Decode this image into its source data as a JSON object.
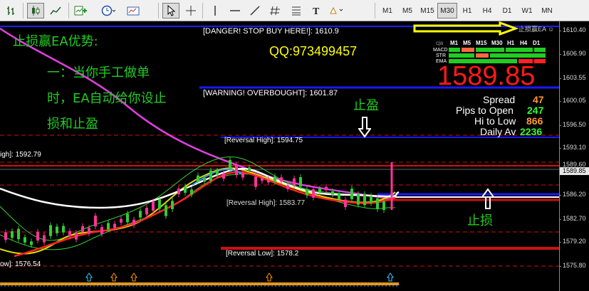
{
  "toolbar": {
    "icons": [
      "bar-chart-icon",
      "candlestick-icon",
      "line-chart-icon",
      "new-chart-icon",
      "clock-icon",
      "zoom-in-icon",
      "zoom-out-icon",
      "templates-icon",
      "cursor-icon",
      "crosshair-icon",
      "vertical-line-icon",
      "horizontal-line-icon",
      "trendline-icon",
      "hash-icon",
      "text-icon",
      "fibonacci-icon",
      "shapes-icon"
    ],
    "timeframes": [
      "M1",
      "M5",
      "M15",
      "M30",
      "H1",
      "H4",
      "D1",
      "W1",
      "MN"
    ],
    "selected_timeframe": "M30"
  },
  "overlay": {
    "heading": "止损赢EA优势:",
    "line1": "一：当你手工做单",
    "line2": "时，EA自动给你设止",
    "line3": "损和止盈",
    "qq": "QQ:973499457",
    "take_profit": "止盈",
    "stop_loss": "止损",
    "corner_label": "止损赢EA ☺",
    "danger": "[DANGER! STOP BUY HERE!]: 1610.9",
    "warning": "[WARNING! OVERBOUGHT]: 1601.87",
    "reversal_high": "[Reversal High]: 1594.75",
    "reversal_low": "[Reversal Low]: 1578.2",
    "left_high": "igh]: 1592.79",
    "left_low": "ow]: 1576.54",
    "overlap_text": "[Reversal High]: 1583.77"
  },
  "panel": {
    "header": [
      "cja",
      "M1",
      "M5",
      "M15",
      "M30",
      "H1",
      "H4",
      "D1"
    ],
    "rows": [
      "MACD",
      "STR",
      "EMA"
    ],
    "price": "1589.85",
    "spread_label": "Spread",
    "spread_value": "47",
    "pips_label": "Pips to Open",
    "pips_value": "247",
    "hilow_label": "Hi to Low",
    "hilow_value": "866",
    "daily_label": "Daily Av",
    "daily_value": "2236"
  },
  "axis": {
    "ticks": [
      "1610.40",
      "1606.90",
      "1603.55",
      "1600.05",
      "1596.50",
      "1593.10",
      "1589.60",
      "1586.20",
      "1582.70",
      "1579.20",
      "1575.80"
    ],
    "current_price": "1589.85"
  },
  "colors": {
    "green_text": "#22cc22",
    "price_red": "#ff1a1a",
    "spread_orange": "#ff9933",
    "value_green": "#33ff33",
    "blue_line": "#1a1aff",
    "red_line": "#cc1111",
    "magenta": "#e040e0",
    "yellow": "#ffff00"
  }
}
